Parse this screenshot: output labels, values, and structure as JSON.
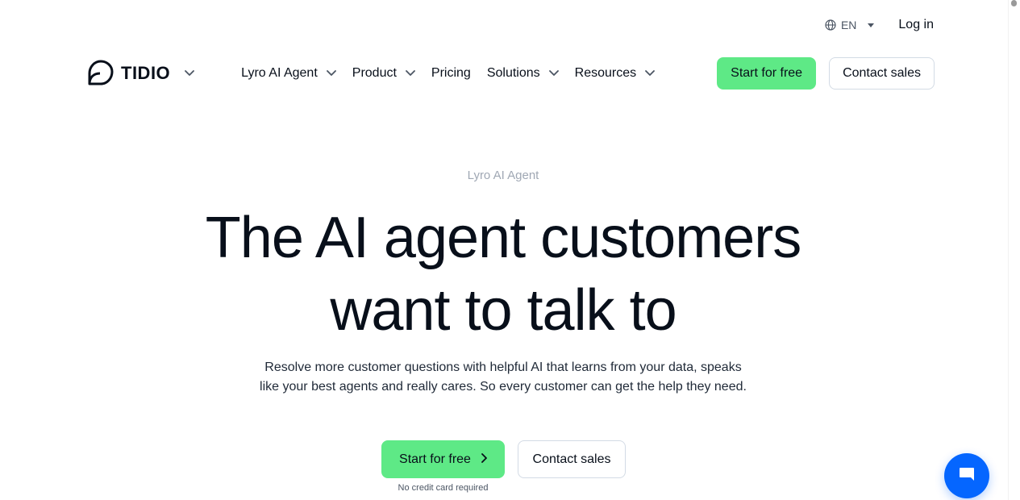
{
  "topbar": {
    "language": "EN",
    "login": "Log in"
  },
  "nav": {
    "logo": "TIDIO",
    "items": [
      {
        "label": "Lyro AI Agent",
        "has_dropdown": true
      },
      {
        "label": "Product",
        "has_dropdown": true
      },
      {
        "label": "Pricing",
        "has_dropdown": false
      },
      {
        "label": "Solutions",
        "has_dropdown": true
      },
      {
        "label": "Resources",
        "has_dropdown": true
      }
    ],
    "start_free": "Start for free",
    "contact_sales": "Contact sales"
  },
  "hero": {
    "eyebrow": "Lyro AI Agent",
    "headline_line1": "The AI agent customers",
    "headline_line2": "want to talk to",
    "sub_line1": "Resolve more customer questions with helpful AI that learns from your data, speaks",
    "sub_line2": "like your best agents and really cares. So every customer can get the help they need.",
    "cta_primary": "Start for free",
    "cta_secondary": "Contact sales",
    "note": "No credit card required"
  },
  "colors": {
    "accent_green": "#5ee986",
    "chat_blue": "#0566ff",
    "text_dark": "#080f1a",
    "eyebrow_gray": "#a0a8b4"
  },
  "icons": {
    "language": "globe-icon",
    "chat": "chat-bubble-icon",
    "dropdown": "chevron-down-icon",
    "cta_arrow": "chevron-right-icon"
  }
}
